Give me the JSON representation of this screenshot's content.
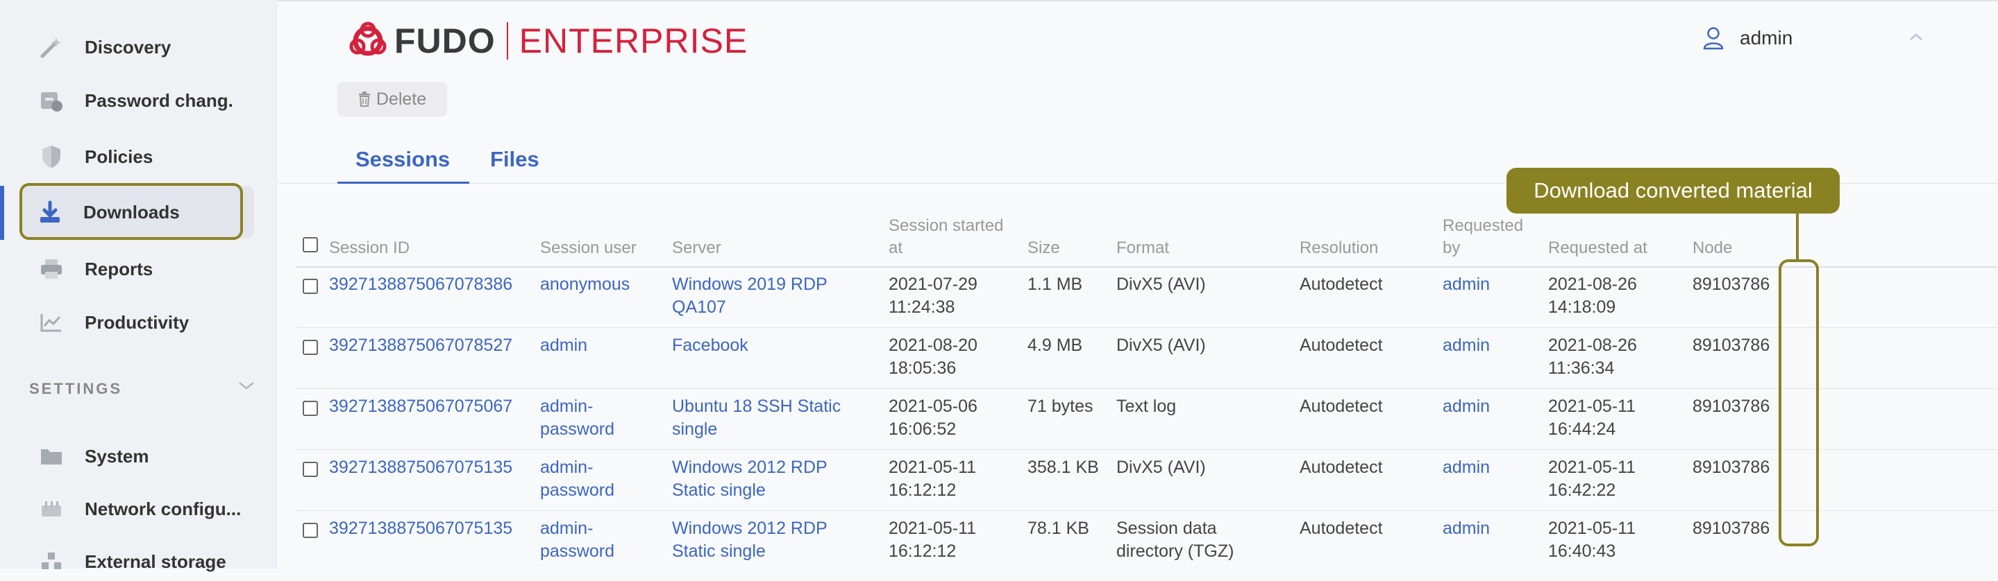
{
  "sidebar": {
    "items": [
      {
        "label": "Discovery",
        "icon": "wand-icon"
      },
      {
        "label": "Password chang.",
        "icon": "password-change-icon"
      },
      {
        "label": "Policies",
        "icon": "shield-icon"
      },
      {
        "label": "Downloads",
        "icon": "download-icon"
      },
      {
        "label": "Reports",
        "icon": "printer-icon"
      },
      {
        "label": "Productivity",
        "icon": "chart-line-icon"
      }
    ],
    "settings_header": "SETTINGS",
    "settings_items": [
      {
        "label": "System",
        "icon": "folder-icon"
      },
      {
        "label": "Network configu...",
        "icon": "network-icon"
      },
      {
        "label": "External storage",
        "icon": "storage-icon"
      }
    ],
    "active_item": "Downloads"
  },
  "header": {
    "logo_left": "FUDO",
    "logo_right": "ENTERPRISE",
    "user_name": "admin"
  },
  "toolbar": {
    "delete_label": "Delete"
  },
  "tabs": [
    {
      "label": "Sessions"
    },
    {
      "label": "Files"
    }
  ],
  "table": {
    "headers": {
      "session_id": "Session ID",
      "session_user": "Session user",
      "server": "Server",
      "started_1": "Session started",
      "started_2": "at",
      "size": "Size",
      "format": "Format",
      "resolution": "Resolution",
      "requested_by_1": "Requested",
      "requested_by_2": "by",
      "requested_at": "Requested at",
      "node": "Node"
    },
    "rows": [
      {
        "id": "3927138875067078386",
        "user1": "anonymous",
        "user2": "",
        "server1": "Windows 2019 RDP",
        "server2": "QA107",
        "date": "2021-07-29",
        "time": "11:24:38",
        "size": "1.1 MB",
        "format1": "DivX5 (AVI)",
        "format2": "",
        "resolution": "Autodetect",
        "requested_by": "admin",
        "req_date": "2021-08-26",
        "req_time": "14:18:09",
        "node": "89103786"
      },
      {
        "id": "3927138875067078527",
        "user1": "admin",
        "user2": "",
        "server1": "Facebook",
        "server2": "",
        "date": "2021-08-20",
        "time": "18:05:36",
        "size": "4.9 MB",
        "format1": "DivX5 (AVI)",
        "format2": "",
        "resolution": "Autodetect",
        "requested_by": "admin",
        "req_date": "2021-08-26",
        "req_time": "11:36:34",
        "node": "89103786"
      },
      {
        "id": "3927138875067075067",
        "user1": "admin-",
        "user2": "password",
        "server1": "Ubuntu 18 SSH Static",
        "server2": "single",
        "date": "2021-05-06",
        "time": "16:06:52",
        "size": "71 bytes",
        "format1": "Text log",
        "format2": "",
        "resolution": "Autodetect",
        "requested_by": "admin",
        "req_date": "2021-05-11",
        "req_time": "16:44:24",
        "node": "89103786"
      },
      {
        "id": "3927138875067075135",
        "user1": "admin-",
        "user2": "password",
        "server1": "Windows 2012 RDP",
        "server2": "Static single",
        "date": "2021-05-11",
        "time": "16:12:12",
        "size": "358.1 KB",
        "format1": "DivX5 (AVI)",
        "format2": "",
        "resolution": "Autodetect",
        "requested_by": "admin",
        "req_date": "2021-05-11",
        "req_time": "16:42:22",
        "node": "89103786"
      },
      {
        "id": "3927138875067075135",
        "user1": "admin-",
        "user2": "password",
        "server1": "Windows 2012 RDP",
        "server2": "Static single",
        "date": "2021-05-11",
        "time": "16:12:12",
        "size": "78.1 KB",
        "format1": "Session data",
        "format2": "directory (TGZ)",
        "resolution": "Autodetect",
        "requested_by": "admin",
        "req_date": "2021-05-11",
        "req_time": "16:40:43",
        "node": "89103786"
      }
    ]
  },
  "callout": {
    "text": "Download converted material"
  },
  "colors": {
    "accent": "#3b66c4",
    "brand_red": "#d4213d",
    "callout": "#8a8122"
  }
}
